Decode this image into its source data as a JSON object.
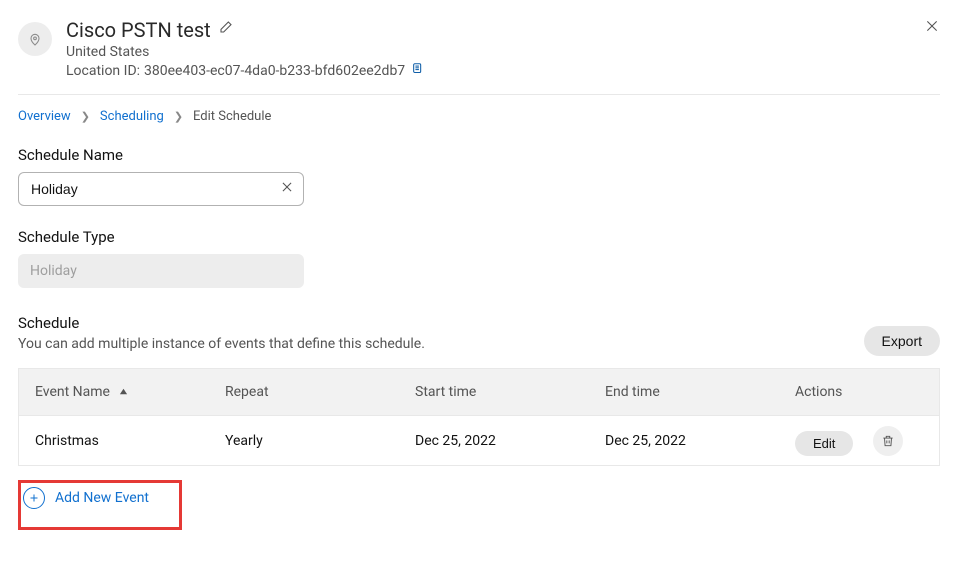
{
  "header": {
    "title": "Cisco PSTN test",
    "country": "United States",
    "location_id_label": "Location ID: ",
    "location_id": "380ee403-ec07-4da0-b233-bfd602ee2db7"
  },
  "breadcrumb": {
    "overview": "Overview",
    "scheduling": "Scheduling",
    "current": "Edit Schedule"
  },
  "fields": {
    "schedule_name_label": "Schedule Name",
    "schedule_name_value": "Holiday",
    "schedule_type_label": "Schedule Type",
    "schedule_type_value": "Holiday"
  },
  "section": {
    "title": "Schedule",
    "desc": "You can add multiple instance of events that define this schedule.",
    "export_label": "Export"
  },
  "table": {
    "columns": {
      "event_name": "Event Name",
      "repeat": "Repeat",
      "start_time": "Start time",
      "end_time": "End time",
      "actions": "Actions"
    },
    "rows": [
      {
        "event_name": "Christmas",
        "repeat": "Yearly",
        "start_time": "Dec 25, 2022",
        "end_time": "Dec 25, 2022",
        "edit_label": "Edit"
      }
    ]
  },
  "add_event_label": "Add New Event"
}
